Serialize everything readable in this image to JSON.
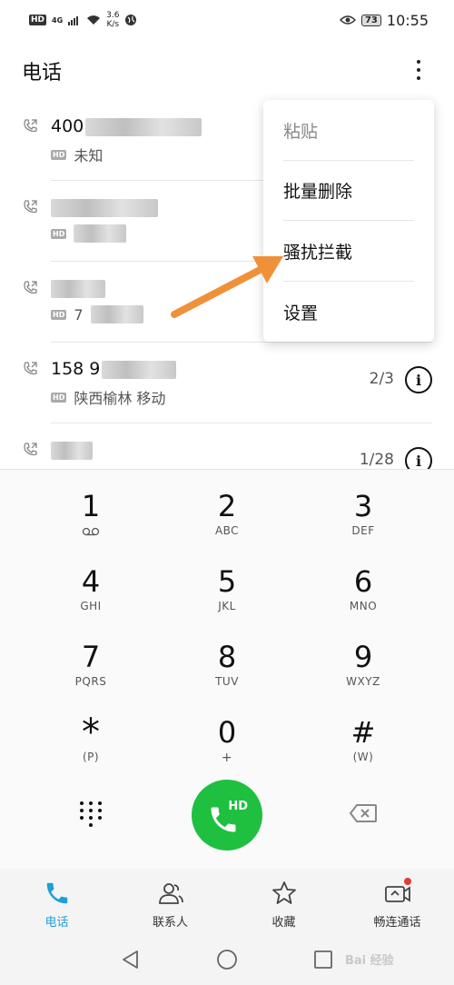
{
  "status_bar": {
    "hd": "HD",
    "signal": "4G",
    "speed_value": "3.6",
    "speed_unit": "K/s",
    "battery": "73",
    "time": "10:55"
  },
  "header": {
    "title": "电话"
  },
  "call_list": [
    {
      "number": "400",
      "location": "未知",
      "count": ""
    },
    {
      "number": "",
      "location": "",
      "count": ""
    },
    {
      "number": "",
      "location": "7",
      "count": ""
    },
    {
      "number": "158 9",
      "location": "陕西榆林 移动",
      "count": "2/3"
    },
    {
      "number": "",
      "location": "",
      "count": "1/28"
    }
  ],
  "hd_tag": "HD",
  "menu": {
    "items": [
      {
        "label": "粘贴",
        "enabled": false
      },
      {
        "label": "批量删除",
        "enabled": true
      },
      {
        "label": "骚扰拦截",
        "enabled": true
      },
      {
        "label": "设置",
        "enabled": true
      }
    ]
  },
  "dialpad": {
    "keys": [
      {
        "digit": "1",
        "letters": ""
      },
      {
        "digit": "2",
        "letters": "ABC"
      },
      {
        "digit": "3",
        "letters": "DEF"
      },
      {
        "digit": "4",
        "letters": "GHI"
      },
      {
        "digit": "5",
        "letters": "JKL"
      },
      {
        "digit": "6",
        "letters": "MNO"
      },
      {
        "digit": "7",
        "letters": "PQRS"
      },
      {
        "digit": "8",
        "letters": "TUV"
      },
      {
        "digit": "9",
        "letters": "WXYZ"
      },
      {
        "digit": "*",
        "letters": "(P)"
      },
      {
        "digit": "0",
        "letters": "+"
      },
      {
        "digit": "#",
        "letters": "(W)"
      }
    ],
    "call_hd": "HD"
  },
  "bottom_nav": [
    {
      "label": "电话",
      "icon": "phone-icon",
      "active": true
    },
    {
      "label": "联系人",
      "icon": "contacts-icon",
      "active": false
    },
    {
      "label": "收藏",
      "icon": "star-icon",
      "active": false
    },
    {
      "label": "畅连通话",
      "icon": "video-call-icon",
      "active": false
    }
  ],
  "watermark": "Bai 经验",
  "colors": {
    "accent": "#1f9fd6",
    "call_green": "#1fbf3f",
    "arrow": "#f0913a",
    "notification": "#e53935"
  }
}
